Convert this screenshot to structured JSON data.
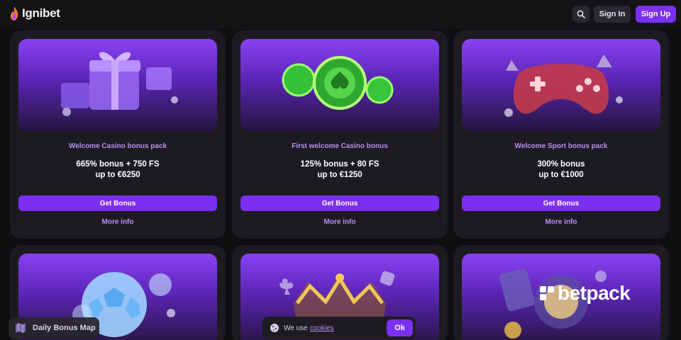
{
  "header": {
    "logo_text": "Ignibet",
    "search_icon": "search-icon",
    "sign_in_label": "Sign In",
    "sign_up_label": "Sign Up"
  },
  "cards": [
    {
      "title": "Welcome Casino bonus pack",
      "offer_line1": "665% bonus + 750 FS",
      "offer_line2": "up to €6250",
      "cta_label": "Get Bonus",
      "more_label": "More info",
      "image": "gift-boxes-illustration"
    },
    {
      "title": "First welcome Casino bonus",
      "offer_line1": "125% bonus + 80 FS",
      "offer_line2": "up to €1250",
      "cta_label": "Get Bonus",
      "more_label": "More info",
      "image": "casino-chips-illustration"
    },
    {
      "title": "Welcome Sport bonus pack",
      "offer_line1": "300% bonus",
      "offer_line2": "up to €1000",
      "cta_label": "Get Bonus",
      "more_label": "More info",
      "image": "gamepad-illustration"
    },
    {
      "image": "soccer-ball-illustration"
    },
    {
      "image": "crown-illustration"
    },
    {
      "image": "cards-roulette-illustration"
    }
  ],
  "daily_bonus_map": {
    "label": "Daily Bonus Map",
    "icon": "map-icon"
  },
  "cookie_banner": {
    "text": "We use",
    "link_text": "cookies",
    "ok_label": "Ok",
    "icon": "cookie-icon"
  },
  "watermark": {
    "text": "betpack"
  },
  "colors": {
    "accent": "#7b2ff0",
    "accent_text": "#b690f5",
    "card_bg": "#1d1b21",
    "page_bg": "#0f0e11"
  }
}
